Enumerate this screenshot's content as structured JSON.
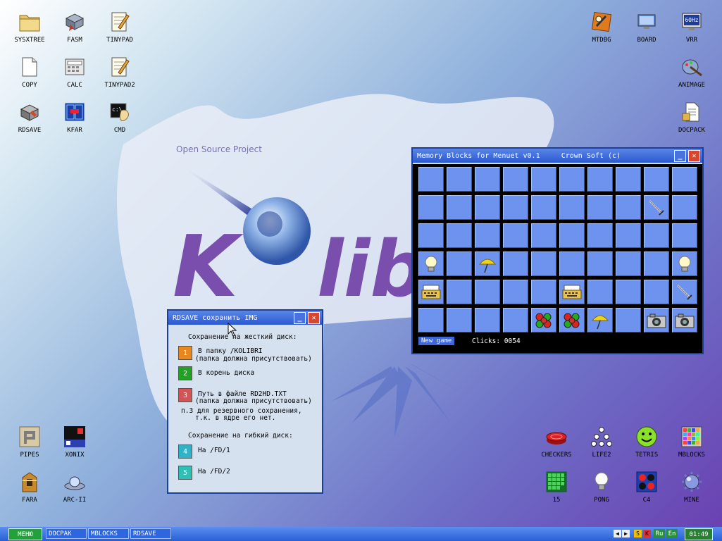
{
  "desktop": {
    "wallpaper_text": "Open Source Project",
    "icons": [
      {
        "label": "SYSXTREE"
      },
      {
        "label": "FASM"
      },
      {
        "label": "TINYPAD"
      },
      {
        "label": "COPY"
      },
      {
        "label": "CALC"
      },
      {
        "label": "TINYPAD2"
      },
      {
        "label": "RDSAVE"
      },
      {
        "label": "KFAR"
      },
      {
        "label": "CMD"
      },
      {
        "label": "MTDBG"
      },
      {
        "label": "BOARD"
      },
      {
        "label": "VRR"
      },
      {
        "label": "ANIMAGE"
      },
      {
        "label": "DOCPACK"
      },
      {
        "label": "PIPES"
      },
      {
        "label": "XONIX"
      },
      {
        "label": "FARA"
      },
      {
        "label": "ARC-II"
      },
      {
        "label": "CHECKERS"
      },
      {
        "label": "LIFE2"
      },
      {
        "label": "TETRIS"
      },
      {
        "label": "MBLOCKS"
      },
      {
        "label": "15"
      },
      {
        "label": "PONG"
      },
      {
        "label": "C4"
      },
      {
        "label": "MINE"
      }
    ],
    "vrr_badge": "60Hz"
  },
  "rdsave": {
    "title": "RDSAVE сохранить IMG",
    "hdd_heading": "Сохранение на жесткий диск:",
    "opt1_num": "1",
    "opt1_line1": "В папку /KOLIBRI",
    "opt1_line2": "(папка должна присутствовать)",
    "opt2_num": "2",
    "opt2_line1": "В корень диска",
    "opt3_num": "3",
    "opt3_line1": "Путь в файле RD2HD.TXT",
    "opt3_line2": "(папка должна присутствовать)",
    "note_line1": "п.3 для резервного сохранения,",
    "note_line2": "т.к. в ядре его нет.",
    "fd_heading": "Сохранение на гибкий диск:",
    "opt4_num": "4",
    "opt4_line1": "На /FD/1",
    "opt5_num": "5",
    "opt5_line1": "На /FD/2",
    "colors": {
      "opt1": "#e8861f",
      "opt2": "#21a221",
      "opt3": "#d35454",
      "opt4": "#2fb3c9",
      "opt5": "#2fbfb5"
    }
  },
  "mblocks": {
    "title": "Memory Blocks for Menuet v0.1",
    "author": "Crown Soft (c)",
    "new_game_label": "New game",
    "clicks_label": "Clicks:",
    "clicks_value": "0054",
    "grid": [
      [
        "",
        "",
        "",
        "",
        "",
        "",
        "",
        "",
        "",
        ""
      ],
      [
        "",
        "",
        "",
        "",
        "",
        "",
        "",
        "",
        "sword",
        ""
      ],
      [
        "",
        "",
        "",
        "",
        "",
        "",
        "",
        "",
        "",
        ""
      ],
      [
        "bulb",
        "",
        "umbrella",
        "",
        "",
        "",
        "",
        "",
        "",
        "bulb"
      ],
      [
        "typewriter",
        "",
        "",
        "",
        "",
        "typewriter",
        "",
        "",
        "",
        "sword"
      ],
      [
        "",
        "",
        "",
        "",
        "molecule",
        "molecule",
        "umbrella",
        "",
        "camera",
        "camera"
      ]
    ]
  },
  "taskbar": {
    "menu_label": "МЕНЮ",
    "buttons": [
      {
        "label": "DOCPAK"
      },
      {
        "label": "MBLOCKS"
      },
      {
        "label": "RDSAVE"
      }
    ],
    "lang_ru": "Ru",
    "lang_en": "En",
    "clock": "01:49"
  }
}
